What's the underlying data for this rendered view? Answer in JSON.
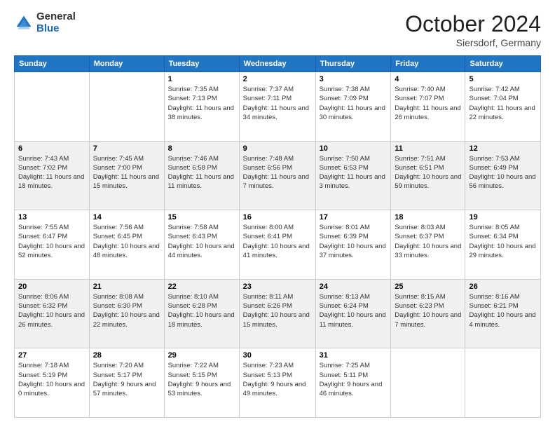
{
  "header": {
    "logo_general": "General",
    "logo_blue": "Blue",
    "month": "October 2024",
    "location": "Siersdorf, Germany"
  },
  "days_of_week": [
    "Sunday",
    "Monday",
    "Tuesday",
    "Wednesday",
    "Thursday",
    "Friday",
    "Saturday"
  ],
  "weeks": [
    [
      {
        "day": "",
        "info": ""
      },
      {
        "day": "",
        "info": ""
      },
      {
        "day": "1",
        "info": "Sunrise: 7:35 AM\nSunset: 7:13 PM\nDaylight: 11 hours and 38 minutes."
      },
      {
        "day": "2",
        "info": "Sunrise: 7:37 AM\nSunset: 7:11 PM\nDaylight: 11 hours and 34 minutes."
      },
      {
        "day": "3",
        "info": "Sunrise: 7:38 AM\nSunset: 7:09 PM\nDaylight: 11 hours and 30 minutes."
      },
      {
        "day": "4",
        "info": "Sunrise: 7:40 AM\nSunset: 7:07 PM\nDaylight: 11 hours and 26 minutes."
      },
      {
        "day": "5",
        "info": "Sunrise: 7:42 AM\nSunset: 7:04 PM\nDaylight: 11 hours and 22 minutes."
      }
    ],
    [
      {
        "day": "6",
        "info": "Sunrise: 7:43 AM\nSunset: 7:02 PM\nDaylight: 11 hours and 18 minutes."
      },
      {
        "day": "7",
        "info": "Sunrise: 7:45 AM\nSunset: 7:00 PM\nDaylight: 11 hours and 15 minutes."
      },
      {
        "day": "8",
        "info": "Sunrise: 7:46 AM\nSunset: 6:58 PM\nDaylight: 11 hours and 11 minutes."
      },
      {
        "day": "9",
        "info": "Sunrise: 7:48 AM\nSunset: 6:56 PM\nDaylight: 11 hours and 7 minutes."
      },
      {
        "day": "10",
        "info": "Sunrise: 7:50 AM\nSunset: 6:53 PM\nDaylight: 11 hours and 3 minutes."
      },
      {
        "day": "11",
        "info": "Sunrise: 7:51 AM\nSunset: 6:51 PM\nDaylight: 10 hours and 59 minutes."
      },
      {
        "day": "12",
        "info": "Sunrise: 7:53 AM\nSunset: 6:49 PM\nDaylight: 10 hours and 56 minutes."
      }
    ],
    [
      {
        "day": "13",
        "info": "Sunrise: 7:55 AM\nSunset: 6:47 PM\nDaylight: 10 hours and 52 minutes."
      },
      {
        "day": "14",
        "info": "Sunrise: 7:56 AM\nSunset: 6:45 PM\nDaylight: 10 hours and 48 minutes."
      },
      {
        "day": "15",
        "info": "Sunrise: 7:58 AM\nSunset: 6:43 PM\nDaylight: 10 hours and 44 minutes."
      },
      {
        "day": "16",
        "info": "Sunrise: 8:00 AM\nSunset: 6:41 PM\nDaylight: 10 hours and 41 minutes."
      },
      {
        "day": "17",
        "info": "Sunrise: 8:01 AM\nSunset: 6:39 PM\nDaylight: 10 hours and 37 minutes."
      },
      {
        "day": "18",
        "info": "Sunrise: 8:03 AM\nSunset: 6:37 PM\nDaylight: 10 hours and 33 minutes."
      },
      {
        "day": "19",
        "info": "Sunrise: 8:05 AM\nSunset: 6:34 PM\nDaylight: 10 hours and 29 minutes."
      }
    ],
    [
      {
        "day": "20",
        "info": "Sunrise: 8:06 AM\nSunset: 6:32 PM\nDaylight: 10 hours and 26 minutes."
      },
      {
        "day": "21",
        "info": "Sunrise: 8:08 AM\nSunset: 6:30 PM\nDaylight: 10 hours and 22 minutes."
      },
      {
        "day": "22",
        "info": "Sunrise: 8:10 AM\nSunset: 6:28 PM\nDaylight: 10 hours and 18 minutes."
      },
      {
        "day": "23",
        "info": "Sunrise: 8:11 AM\nSunset: 6:26 PM\nDaylight: 10 hours and 15 minutes."
      },
      {
        "day": "24",
        "info": "Sunrise: 8:13 AM\nSunset: 6:24 PM\nDaylight: 10 hours and 11 minutes."
      },
      {
        "day": "25",
        "info": "Sunrise: 8:15 AM\nSunset: 6:23 PM\nDaylight: 10 hours and 7 minutes."
      },
      {
        "day": "26",
        "info": "Sunrise: 8:16 AM\nSunset: 6:21 PM\nDaylight: 10 hours and 4 minutes."
      }
    ],
    [
      {
        "day": "27",
        "info": "Sunrise: 7:18 AM\nSunset: 5:19 PM\nDaylight: 10 hours and 0 minutes."
      },
      {
        "day": "28",
        "info": "Sunrise: 7:20 AM\nSunset: 5:17 PM\nDaylight: 9 hours and 57 minutes."
      },
      {
        "day": "29",
        "info": "Sunrise: 7:22 AM\nSunset: 5:15 PM\nDaylight: 9 hours and 53 minutes."
      },
      {
        "day": "30",
        "info": "Sunrise: 7:23 AM\nSunset: 5:13 PM\nDaylight: 9 hours and 49 minutes."
      },
      {
        "day": "31",
        "info": "Sunrise: 7:25 AM\nSunset: 5:11 PM\nDaylight: 9 hours and 46 minutes."
      },
      {
        "day": "",
        "info": ""
      },
      {
        "day": "",
        "info": ""
      }
    ]
  ]
}
